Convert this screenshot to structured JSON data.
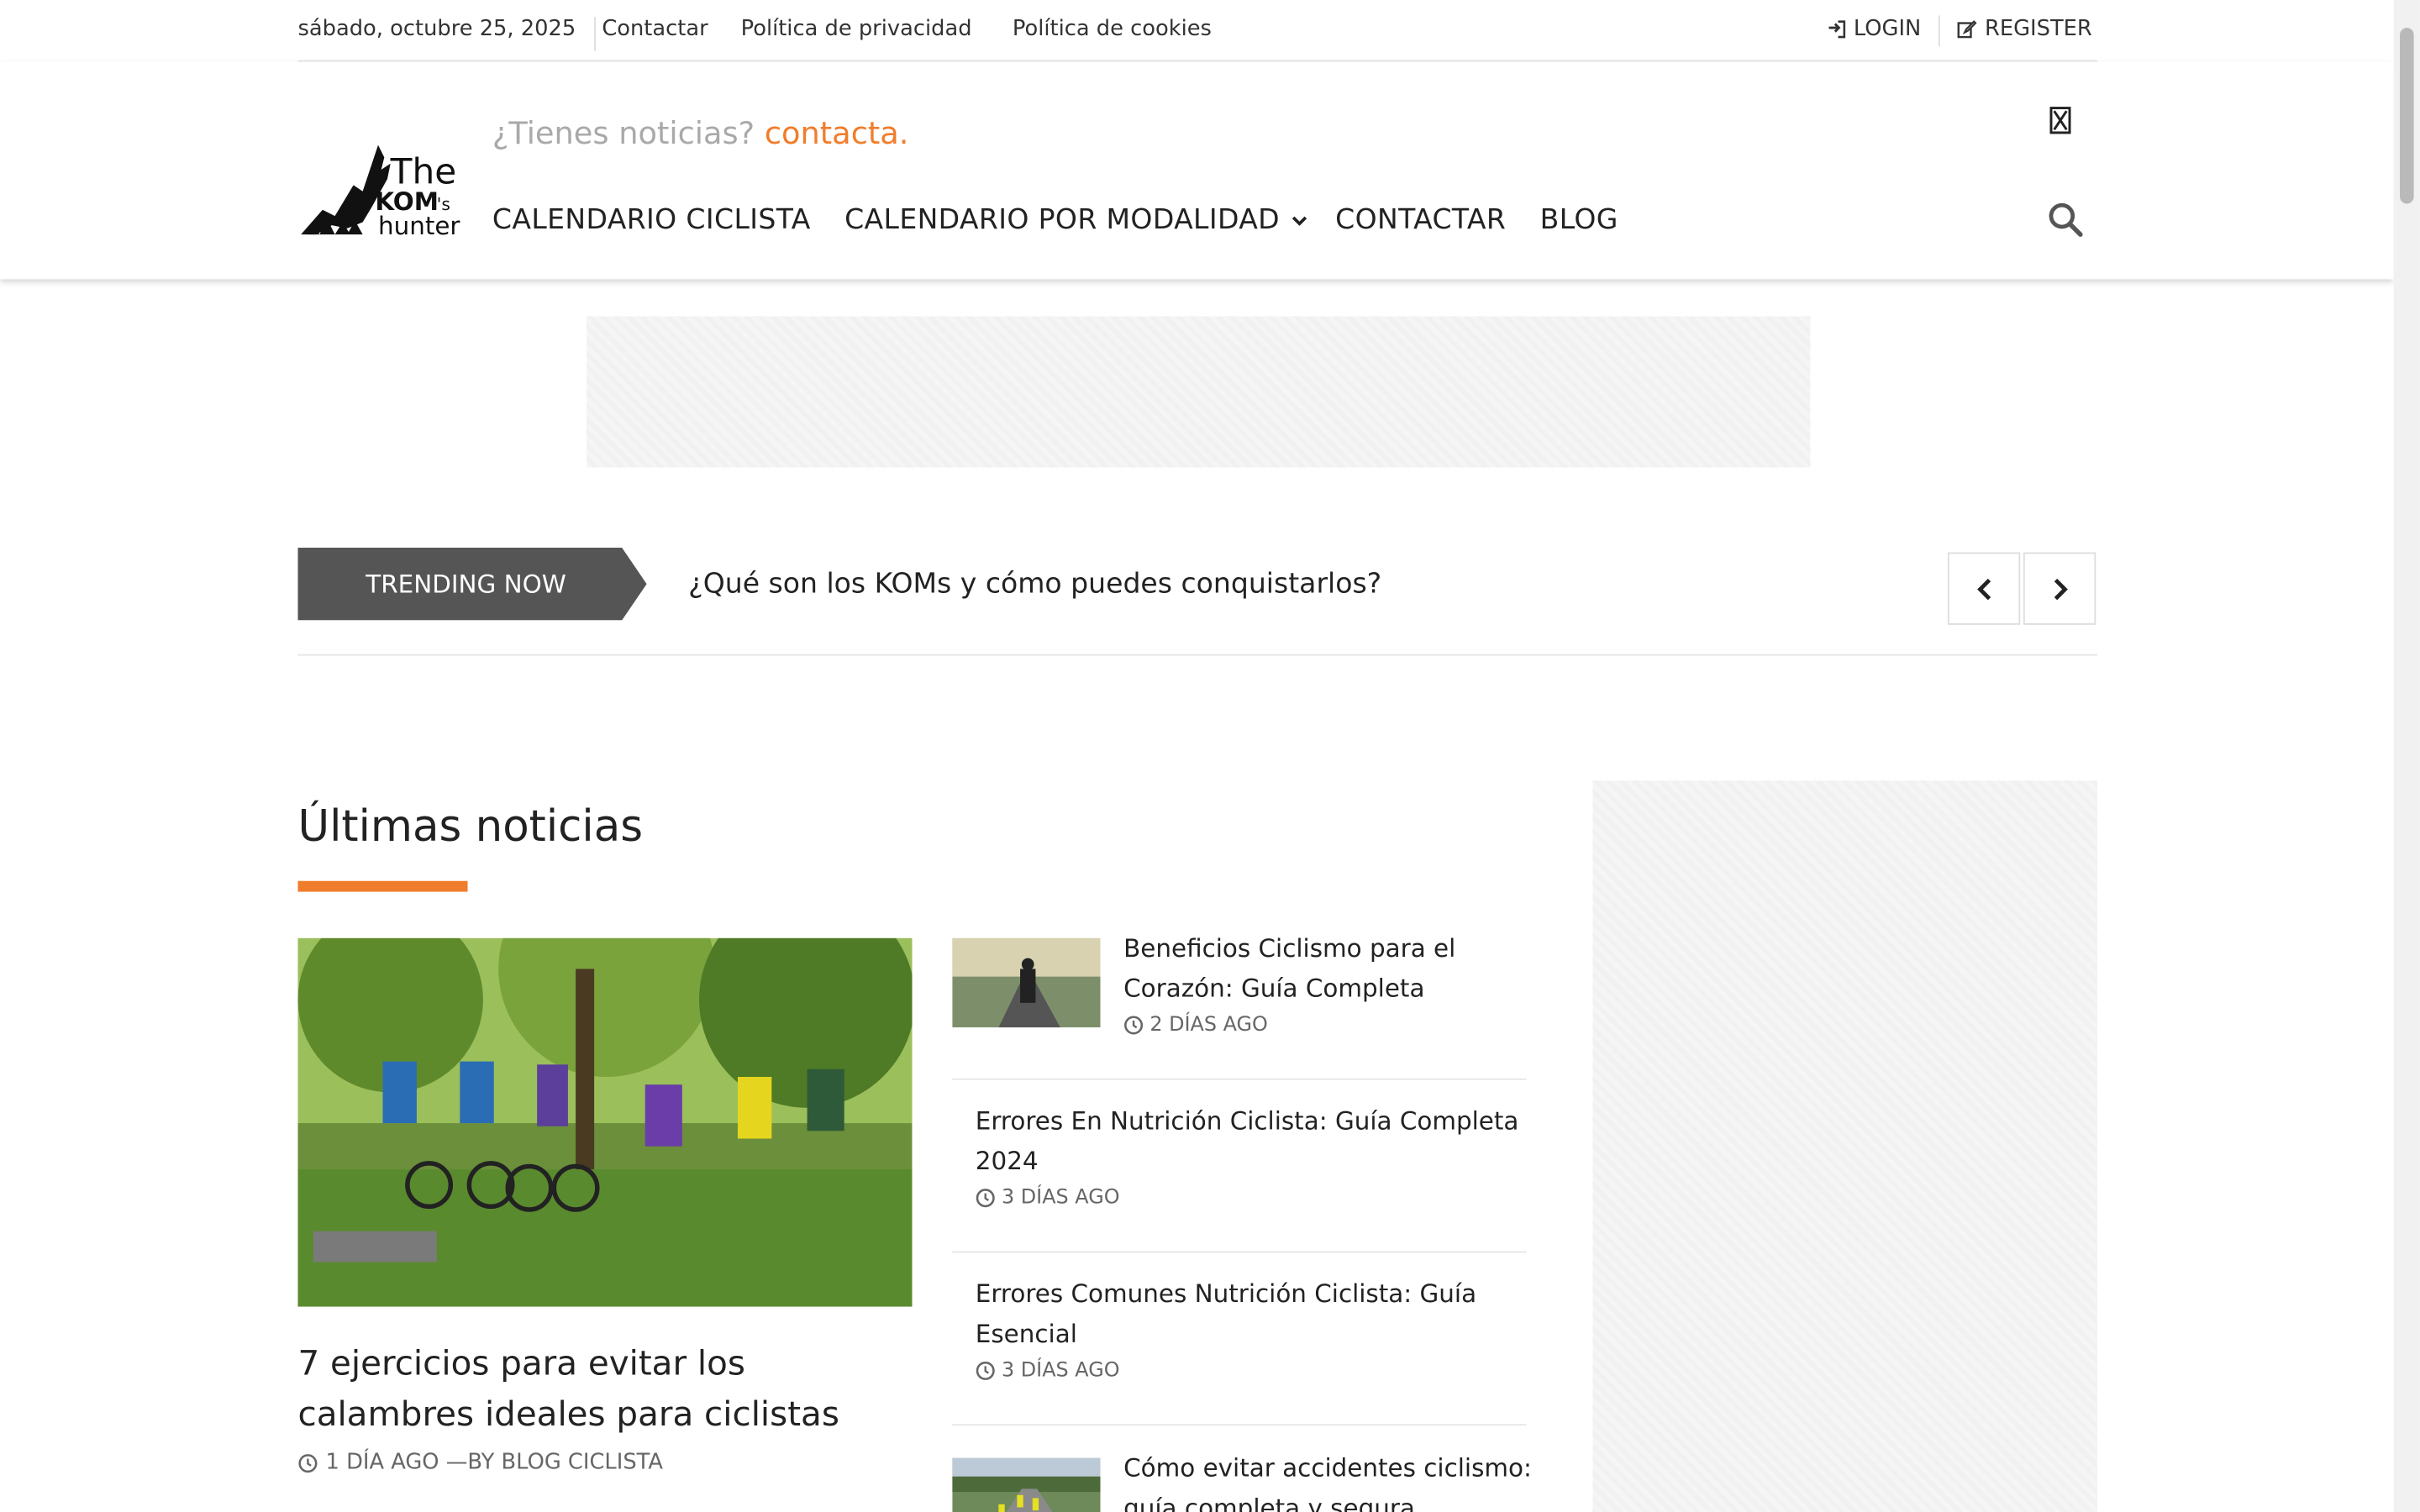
{
  "topbar": {
    "date": "sábado, octubre 25, 2025",
    "links": [
      "Contactar",
      "Política de privacidad",
      "Política de cookies"
    ],
    "login": "LOGIN",
    "register": "REGISTER"
  },
  "header": {
    "tagline_prefix": "¿Tienes noticias?",
    "tagline_accent": "contacta.",
    "nav": [
      "CALENDARIO CICLISTA",
      "CALENDARIO POR MODALIDAD",
      "CONTACTAR",
      "BLOG"
    ],
    "logo_text": {
      "the": "The",
      "kom": "KOM",
      "s": "'s",
      "hunter": "hunter"
    }
  },
  "trending": {
    "label": "TRENDING NOW",
    "headline": "¿Qué son los KOMs y cómo puedes conquistarlos?"
  },
  "main": {
    "section_title": "Últimas noticias",
    "feature": {
      "title": "7 ejercicios para evitar los calambres ideales para ciclistas",
      "meta": "1 DÍA AGO —BY BLOG CICLISTA"
    },
    "list": [
      {
        "title": "Beneficios Ciclismo para el Corazón: Guía Completa",
        "meta": "2 DÍAS AGO"
      },
      {
        "title": "Errores En Nutrición Ciclista: Guía Completa 2024",
        "meta": "3 DÍAS AGO"
      },
      {
        "title": "Errores Comunes Nutrición Ciclista: Guía Esencial",
        "meta": "3 DÍAS AGO"
      },
      {
        "title": "Cómo evitar accidentes ciclismo: guía completa y segura",
        "meta": ""
      }
    ]
  },
  "colors": {
    "accent": "#f07d2b",
    "trending_bg": "#555555"
  },
  "icons": [
    "login-icon",
    "register-icon",
    "close-icon",
    "search-icon",
    "chevron-down-icon",
    "chevron-left-icon",
    "chevron-right-icon",
    "clock-icon"
  ]
}
